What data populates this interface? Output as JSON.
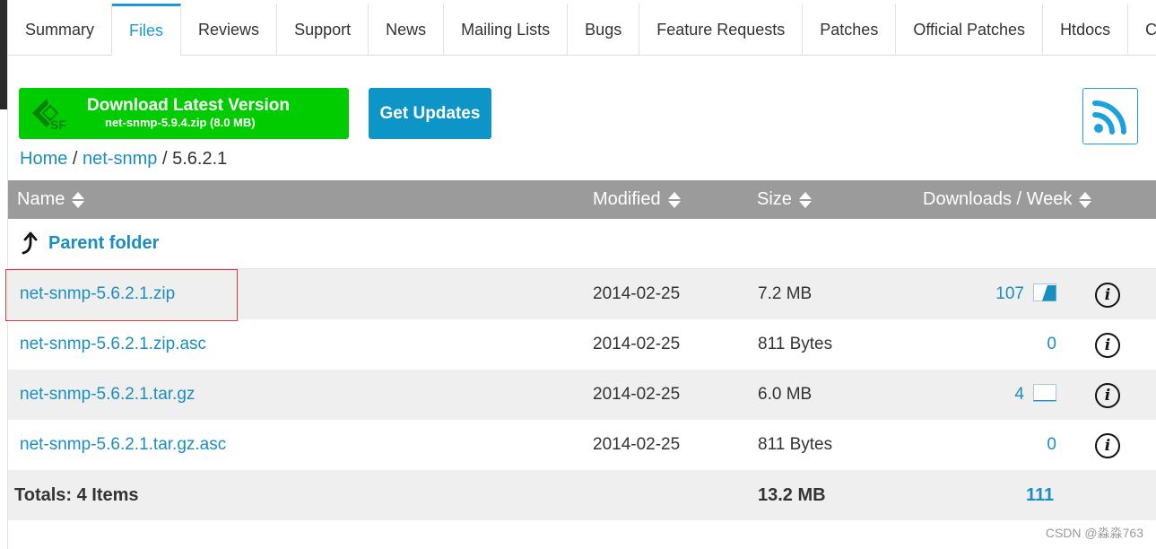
{
  "tabs": [
    "Summary",
    "Files",
    "Reviews",
    "Support",
    "News",
    "Mailing Lists",
    "Bugs",
    "Feature Requests",
    "Patches",
    "Official Patches",
    "Htdocs",
    "Code"
  ],
  "active_tab": "Files",
  "download": {
    "title": "Download Latest Version",
    "subtitle": "net-snmp-5.9.4.zip (8.0 MB)",
    "logo_text": "SF"
  },
  "get_updates_label": "Get Updates",
  "breadcrumb": {
    "home": "Home",
    "project": "net-snmp",
    "current": "5.6.2.1",
    "separator": "/"
  },
  "table": {
    "headers": {
      "name": "Name",
      "modified": "Modified",
      "size": "Size",
      "downloads": "Downloads / Week"
    },
    "parent_folder": "Parent folder",
    "rows": [
      {
        "name": "net-snmp-5.6.2.1.zip",
        "modified": "2014-02-25",
        "size": "7.2 MB",
        "downloads": "107",
        "sparkline": true
      },
      {
        "name": "net-snmp-5.6.2.1.zip.asc",
        "modified": "2014-02-25",
        "size": "811 Bytes",
        "downloads": "0",
        "sparkline": false
      },
      {
        "name": "net-snmp-5.6.2.1.tar.gz",
        "modified": "2014-02-25",
        "size": "6.0 MB",
        "downloads": "4",
        "sparkline": true
      },
      {
        "name": "net-snmp-5.6.2.1.tar.gz.asc",
        "modified": "2014-02-25",
        "size": "811 Bytes",
        "downloads": "0",
        "sparkline": false
      }
    ],
    "totals": {
      "label": "Totals: 4 Items",
      "size": "13.2 MB",
      "downloads": "111"
    }
  },
  "info_glyph": "i",
  "watermark": "CSDN @淼淼763",
  "colors": {
    "accent": "#1d9bd6",
    "download_green": "#00cc00",
    "updates_blue": "#0d95c8",
    "header_gray": "#9b9b9b",
    "highlight_red": "#e0333a"
  }
}
